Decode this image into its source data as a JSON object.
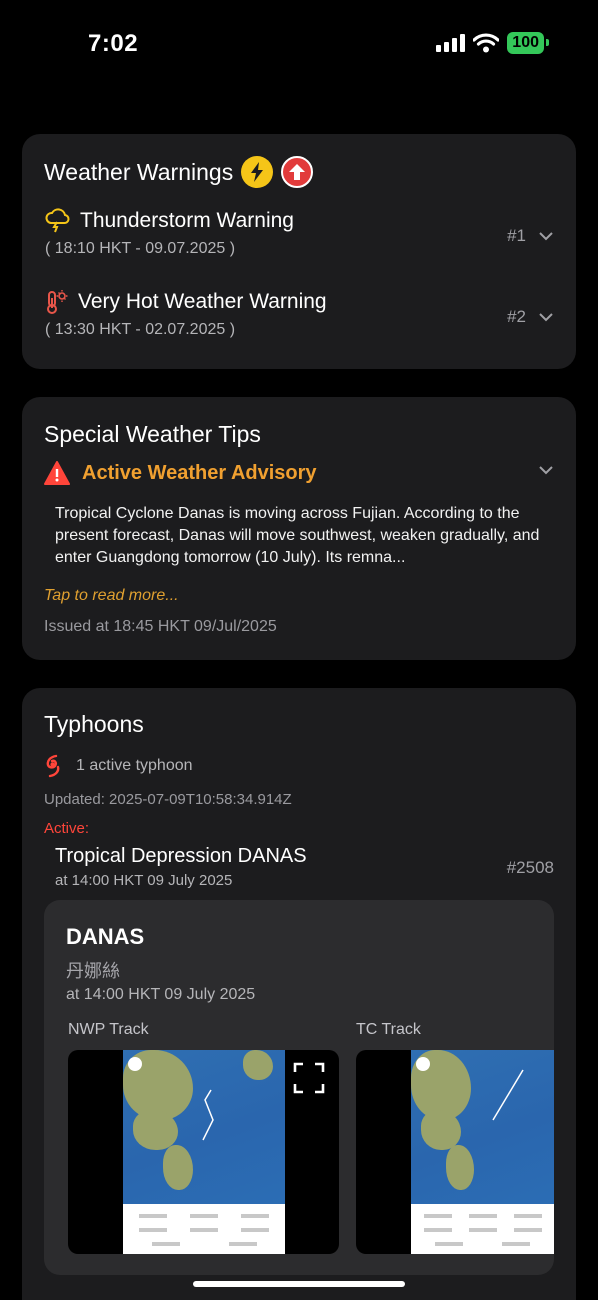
{
  "status_bar": {
    "time": "7:02",
    "battery": "100"
  },
  "warnings": {
    "title": "Weather Warnings",
    "items": [
      {
        "name": "Thunderstorm Warning",
        "time": "( 18:10 HKT - 09.07.2025 )",
        "number": "#1",
        "icon": "thunderstorm-cloud-icon"
      },
      {
        "name": "Very Hot Weather Warning",
        "time": "( 13:30 HKT - 02.07.2025 )",
        "number": "#2",
        "icon": "thermometer-sun-icon"
      }
    ]
  },
  "tips": {
    "title": "Special Weather Tips",
    "advisory_label": "Active Weather Advisory",
    "body": "Tropical Cyclone Danas is moving across Fujian. According to the present forecast, Danas will move southwest, weaken gradually, and enter Guangdong tomorrow (10 July). Its remna...",
    "read_more": "Tap to read more...",
    "issued": "Issued at 18:45 HKT 09/Jul/2025"
  },
  "typhoons": {
    "title": "Typhoons",
    "count_text": "1 active typhoon",
    "updated": "Updated: 2025-07-09T10:58:34.914Z",
    "active_label": "Active:",
    "storm_name": "Tropical Depression DANAS",
    "storm_time": "at 14:00 HKT 09 July 2025",
    "storm_number": "#2508",
    "detail": {
      "name": "DANAS",
      "name_cn": "丹娜絲",
      "time": "at 14:00 HKT 09 July 2025",
      "nwp_label": "NWP Track",
      "tc_label": "TC Track"
    }
  },
  "colors": {
    "accent_orange": "#f0a030",
    "active_red": "#ff453a",
    "battery_green": "#34c759"
  }
}
